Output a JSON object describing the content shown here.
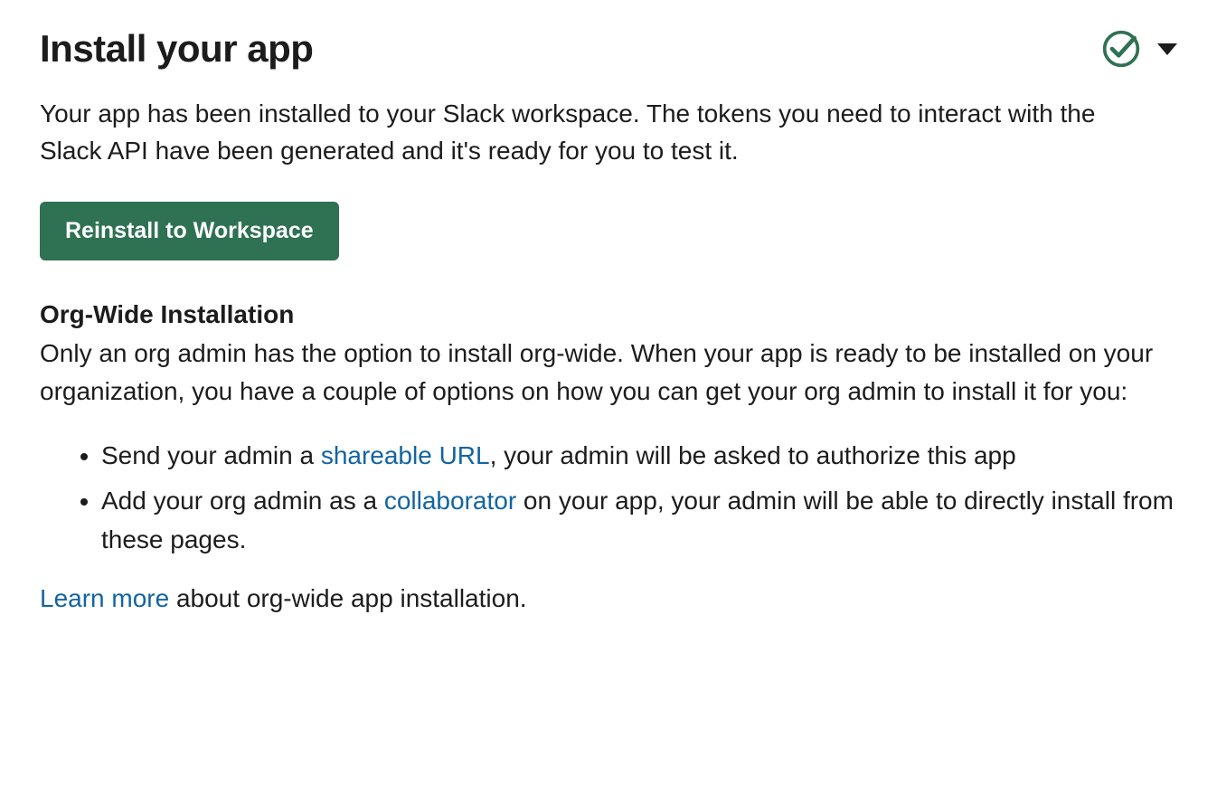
{
  "header": {
    "title": "Install your app"
  },
  "intro": "Your app has been installed to your Slack workspace. The tokens you need to interact with the Slack API have been generated and it's ready for you to test it.",
  "button": {
    "reinstall_label": "Reinstall to Workspace"
  },
  "orgwide": {
    "heading": "Org-Wide Installation",
    "body": "Only an org admin has the option to install org-wide. When your app is ready to be installed on your organization, you have a couple of options on how you can get your org admin to install it for you:",
    "options": {
      "item1_prefix": "Send your admin a ",
      "item1_link": "shareable URL",
      "item1_suffix": ", your admin will be asked to authorize this app",
      "item2_prefix": "Add your org admin as a ",
      "item2_link": "collaborator",
      "item2_suffix": " on your app, your admin will be able to directly install from these pages."
    },
    "footer_link": "Learn more",
    "footer_suffix": " about org-wide app installation."
  },
  "colors": {
    "accent_green": "#2f7153",
    "link_blue": "#1264a3"
  }
}
